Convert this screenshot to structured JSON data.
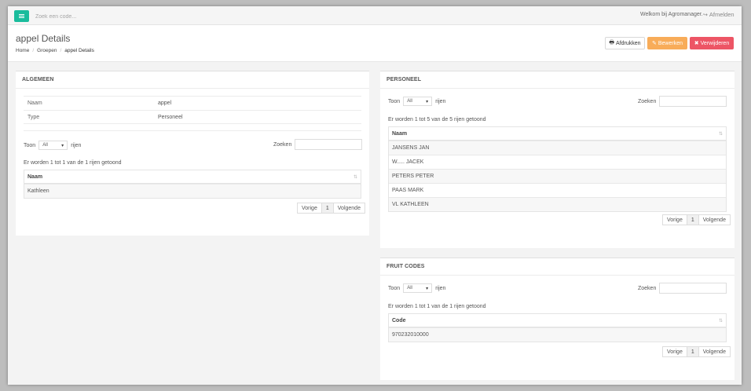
{
  "topbar": {
    "search_placeholder": "Zoek een code...",
    "welcome": "Welkom bij Agromanager.",
    "logout": "Afmelden"
  },
  "header": {
    "title": "appel Details",
    "breadcrumb": [
      "Home",
      "Groepen",
      "appel Details"
    ],
    "print_label": "Afdrukken",
    "edit_label": "Bewerken",
    "delete_label": "Verwijderen"
  },
  "colors": {
    "menu": "#1abc9c",
    "edit": "#f8ac59",
    "delete": "#ed5565"
  },
  "algemeen": {
    "title": "ALGEMEEN",
    "fields": [
      {
        "key": "Naam",
        "value": "appel"
      },
      {
        "key": "Type",
        "value": "Personeel"
      }
    ],
    "show_label": "Toon",
    "show_value": "All",
    "rows_label": "rijen",
    "search_label": "Zoeken",
    "info": "Er worden 1 tot 1 van de 1 rijen getoond",
    "column": "Naam",
    "rows": [
      "Kathleen"
    ],
    "prev": "Vorige",
    "page": "1",
    "next": "Volgende"
  },
  "personeel": {
    "title": "PERSONEEL",
    "show_label": "Toon",
    "show_value": "All",
    "rows_label": "rijen",
    "search_label": "Zoeken",
    "info": "Er worden 1 tot 5 van de 5 rijen getoond",
    "column": "Naam",
    "rows": [
      "JANSENS JAN",
      "W..... JACEK",
      "PETERS PETER",
      "PAAS MARK",
      "VL KATHLEEN"
    ],
    "prev": "Vorige",
    "page": "1",
    "next": "Volgende"
  },
  "fruitcodes": {
    "title": "FRUIT CODES",
    "show_label": "Toon",
    "show_value": "All",
    "rows_label": "rijen",
    "search_label": "Zoeken",
    "info": "Er worden 1 tot 1 van de 1 rijen getoond",
    "column": "Code",
    "rows": [
      "970232010000"
    ],
    "prev": "Vorige",
    "page": "1",
    "next": "Volgende"
  }
}
